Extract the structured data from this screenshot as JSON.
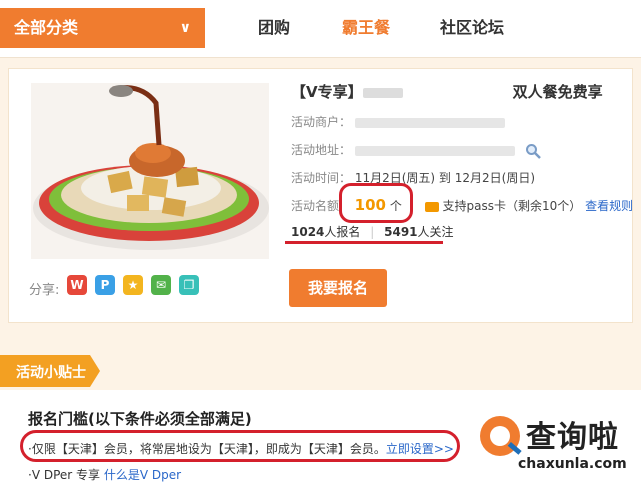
{
  "topbar": {
    "category_label": "全部分类",
    "nav": [
      "团购",
      "霸王餐",
      "社区论坛"
    ]
  },
  "deal": {
    "title_prefix": "【V专享】",
    "title_suffix": "双人餐免费享",
    "merchant_label": "活动商户：",
    "address_label": "活动地址：",
    "time_label": "活动时间：",
    "time_value": "11月2日(周五) 到 12月2日(周日)",
    "quota_label": "活动名额",
    "quota_value": "100",
    "quota_unit": "个",
    "pass_text": "支持pass卡（剩余10个）",
    "rules_link": "查看规则",
    "signups": "1024",
    "signups_unit": "人报名",
    "followers": "5491",
    "followers_unit": "人关注",
    "join_button": "我要报名",
    "share_label": "分享:"
  },
  "tips": {
    "ribbon": "活动小贴士",
    "cond_title": "报名门槛(以下条件必须全部满足)",
    "cond_line1": "·仅限【天津】会员，将常居地设为【天津】，即成为【天津】会员。",
    "cond_link": "立即设置>>",
    "cond_line2": "·V DPer 专享",
    "cond_line2_link": "什么是V Dper"
  },
  "watermark": {
    "brand": "查询啦",
    "url": "chaxunla.com"
  },
  "colors": {
    "accent": "#f07c2f",
    "quota": "#f39800",
    "highlight": "#d4202c",
    "link": "#2a67c9"
  }
}
